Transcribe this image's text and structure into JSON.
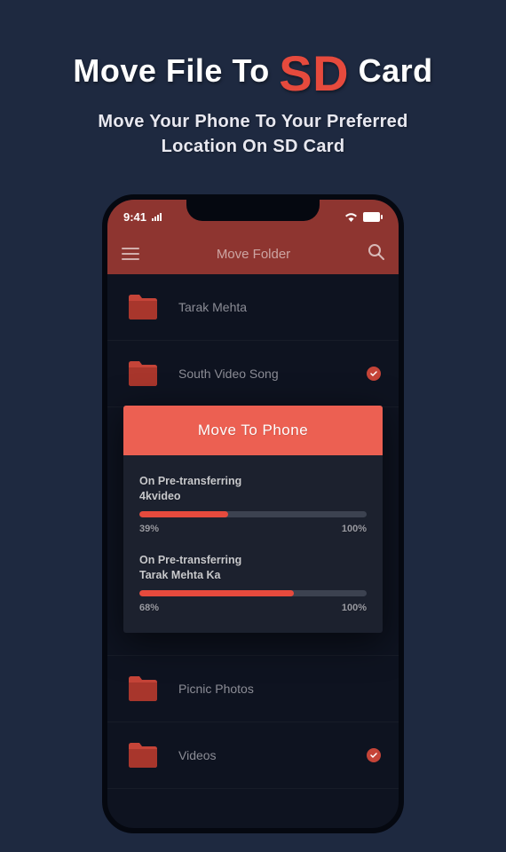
{
  "promo": {
    "title_before": "Move File To ",
    "title_highlight": "SD",
    "title_after": " Card",
    "subtitle_line1": "Move Your Phone To Your Preferred",
    "subtitle_line2": "Location On SD Card"
  },
  "status_bar": {
    "time": "9:41"
  },
  "app_header": {
    "title": "Move Folder"
  },
  "folders": [
    {
      "name": "Tarak Mehta",
      "checked": false
    },
    {
      "name": "South Video Song",
      "checked": true
    },
    {
      "name": "Picnic Photos",
      "checked": false
    },
    {
      "name": "Videos",
      "checked": true
    }
  ],
  "dialog": {
    "title": "Move To Phone",
    "transfers": [
      {
        "status": "On Pre-transferring",
        "name": "4kvideo",
        "current_pct": "39%",
        "total_pct": "100%",
        "fill": 39
      },
      {
        "status": "On Pre-transferring",
        "name": "Tarak Mehta Ka",
        "current_pct": "68%",
        "total_pct": "100%",
        "fill": 68
      }
    ]
  }
}
